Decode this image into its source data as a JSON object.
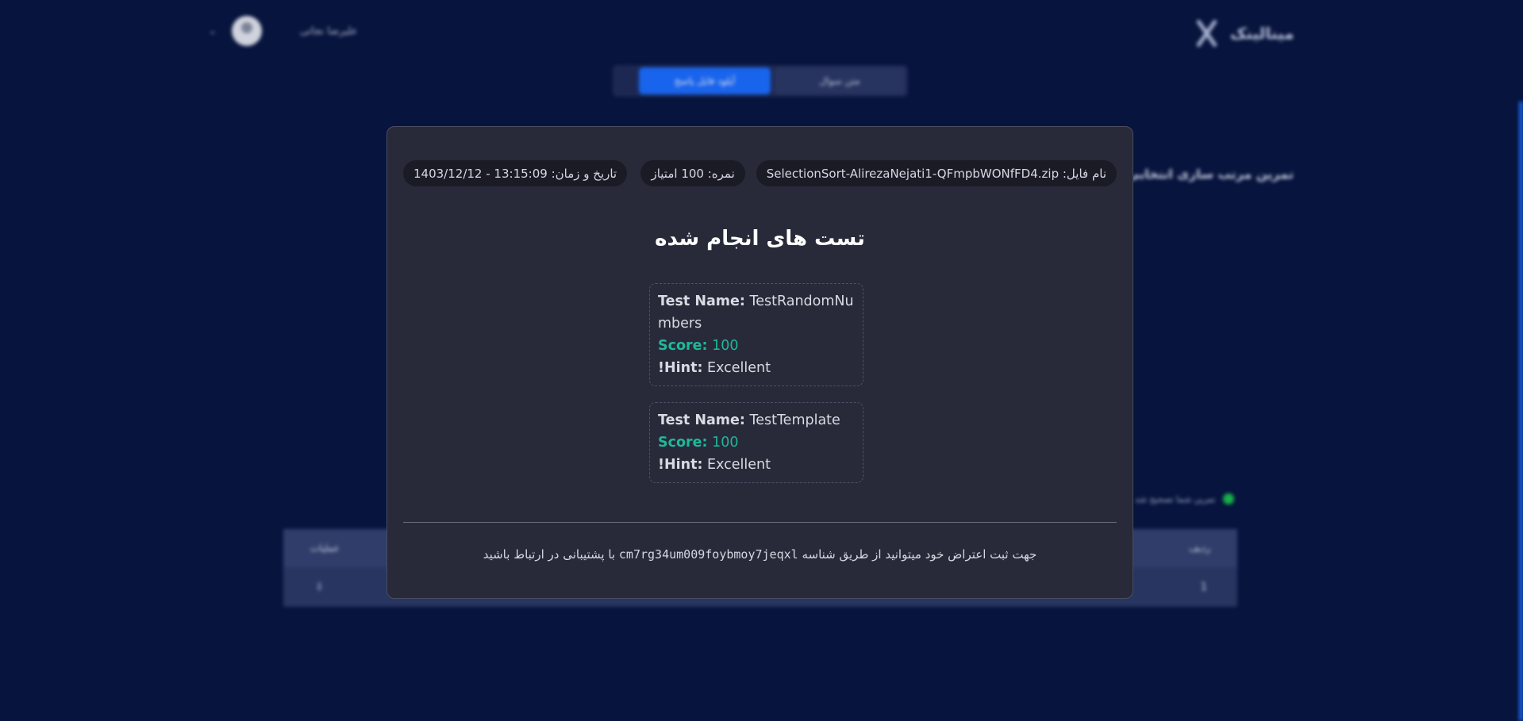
{
  "header": {
    "logo_text": "مینالینک",
    "username": "علیرضا نجاتی",
    "tabs": [
      {
        "label": "متن سوال"
      },
      {
        "label": "آپلود فایل پاسخ"
      }
    ]
  },
  "background": {
    "heading": "تمرین مرتب سازی انتخابی",
    "status_text": "تمرین شما تصحیح شد",
    "table": {
      "headers": [
        "ردیف",
        "عملیات"
      ],
      "row": [
        "1",
        "⇩"
      ]
    }
  },
  "modal": {
    "file_chip": "نام فایل: SelectionSort-AlirezaNejati1-QFmpbWONfFD4.zip",
    "score_chip": "نمره: 100 امتیاز",
    "datetime_chip": "تاریخ و زمان: 13:15:09 - 1403/12/12",
    "title": "تست های انجام شده",
    "labels": {
      "test_name": "Test Name:",
      "score": "Score:",
      "hint": "Hint:"
    },
    "tests": [
      {
        "name": "TestRandomNumbers",
        "score": "100",
        "hint": "Excellent",
        "hint_prefix": "!"
      },
      {
        "name": "TestTemplate",
        "score": "100",
        "hint": "Excellent",
        "hint_prefix": "!"
      }
    ],
    "footer_before": "جهت ثبت اعتراض خود میتوانید از طریق شناسه",
    "footer_id": "cm7rg34um009foybmoy7jeqxl",
    "footer_after": "با پشتیبانی در ارتباط باشید"
  }
}
